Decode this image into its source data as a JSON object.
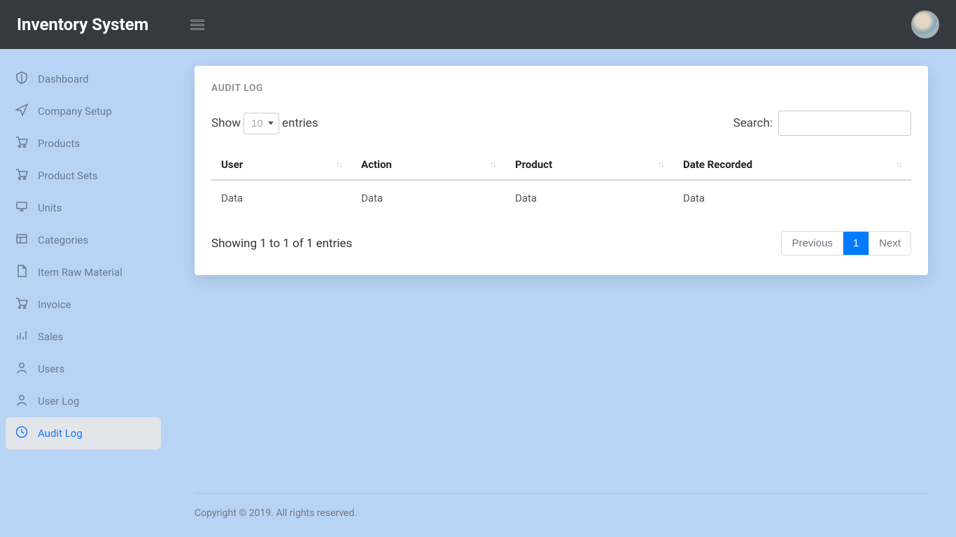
{
  "brand": "Inventory System",
  "sidebar": {
    "items": [
      {
        "label": "Dashboard",
        "icon": "shield"
      },
      {
        "label": "Company Setup",
        "icon": "send"
      },
      {
        "label": "Products",
        "icon": "cart"
      },
      {
        "label": "Product Sets",
        "icon": "cart"
      },
      {
        "label": "Units",
        "icon": "monitor"
      },
      {
        "label": "Categories",
        "icon": "layout"
      },
      {
        "label": "Item Raw Material",
        "icon": "file"
      },
      {
        "label": "Invoice",
        "icon": "cart"
      },
      {
        "label": "Sales",
        "icon": "bars"
      },
      {
        "label": "Users",
        "icon": "user"
      },
      {
        "label": "User Log",
        "icon": "user"
      },
      {
        "label": "Audit Log",
        "icon": "clock"
      }
    ],
    "active_index": 11
  },
  "card": {
    "title": "AUDIT LOG",
    "show_label_prefix": "Show",
    "show_label_suffix": "entries",
    "show_value": "10",
    "search_label": "Search:",
    "columns": [
      "User",
      "Action",
      "Product",
      "Date Recorded"
    ],
    "rows": [
      {
        "user": "Data",
        "action": "Data",
        "product": "Data",
        "date": "Data"
      }
    ],
    "info": "Showing 1 to 1 of 1 entries",
    "pagination": {
      "prev": "Previous",
      "next": "Next",
      "pages": [
        "1"
      ],
      "active": "1"
    }
  },
  "footer": "Copyright © 2019. All rights reserved."
}
